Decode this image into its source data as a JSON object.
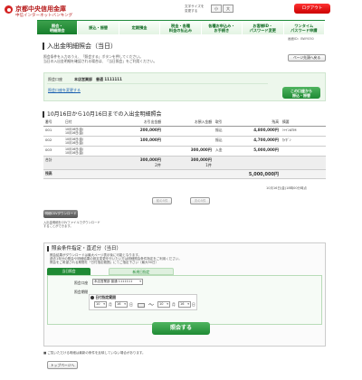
{
  "header": {
    "bank_name": "京都中央信用金庫",
    "service_name": "中信インターネットバンキング",
    "text_size_label": "文字サイズを\n変更する",
    "size_small": "小",
    "size_large": "大",
    "logout_label": "ログアウト"
  },
  "nav": {
    "items": [
      {
        "label": "照会・\n明細照会",
        "active": true
      },
      {
        "label": "振込・振替",
        "active": false
      },
      {
        "label": "定期預金",
        "active": false
      },
      {
        "label": "税金・各種\n料金の払込み",
        "active": false
      },
      {
        "label": "各種お申込み・\nお手続き",
        "active": false
      },
      {
        "label": "お客様ID・\nパスワード変更",
        "active": false
      },
      {
        "label": "ワンタイム\nパスワード申請",
        "active": false
      }
    ]
  },
  "screen_id": "画面ID：BWY050",
  "page": {
    "title": "入出金明細照会（当日）",
    "desc_1": "照会条件を入力のうえ、「照会する」ボタンを押してください。",
    "desc_2": "当日の入出金明細を確認される場合は、「当日照会」をご利用ください。",
    "page_top_button": "ページ先頭へ戻る"
  },
  "account": {
    "label": "照会口座",
    "value": "本店営業部　普通 1111111",
    "change_link": "照会口座を変更する",
    "transfer_button": "この口座から\n振込・振替"
  },
  "statement": {
    "title": "10月16日から10月16日までの入出金明細照会",
    "headers": [
      "番号",
      "日付",
      "お引出金額",
      "お預入金額",
      "取引",
      "残高",
      "摘要"
    ],
    "rows": [
      {
        "no": "001",
        "date": "10月16日(金)\n10月16日(金)",
        "withdraw": "200,000円",
        "deposit": "",
        "type": "振込",
        "balance": "4,800,000円",
        "memo": "ｼｬｲﾝATM"
      },
      {
        "no": "002",
        "date": "10月16日(金)\n10月16日(金)",
        "withdraw": "100,000円",
        "deposit": "",
        "type": "振込",
        "balance": "4,700,000円",
        "memo": "ｶｲﾀﾞﾝ"
      },
      {
        "no": "003",
        "date": "10月16日(金)\n10月16日(金)",
        "withdraw": "",
        "deposit": "300,000円",
        "type": "入金",
        "balance": "5,000,000円",
        "memo": ""
      }
    ],
    "total_label": "合計",
    "total_withdraw": "300,000円",
    "total_withdraw_count": "2件",
    "total_deposit": "300,000円",
    "total_deposit_count": "1件",
    "balance_label": "残高",
    "balance_value": "5,000,000円",
    "as_of": "10月16日(金)18時00分時点"
  },
  "pager": {
    "prev": "前の5件",
    "next": "次の5件"
  },
  "download": {
    "button": "明細CSVダウンロード",
    "note_1": "入出金明細をCSVファイルでダウンロード",
    "note_2": "することができます。"
  },
  "criteria": {
    "title": "照会条件指定・直近分（当日）",
    "desc_1": "照会結果がダウンロードは最大ページ表示後に可能となります。",
    "desc_2": "過去1年分の照会や明細結果の設定変更を行いたい方は明細照会条件指定をご利用ください。",
    "desc_3": "照会をご希望される期間を「日付指定範囲」にてご指定下さい（最大90日）",
    "tab_today": "当日照会",
    "tab_new": "新規日指定",
    "account_label": "照会口座",
    "account_value": "本店営業部 普通 1111111",
    "period_label": "照会期間",
    "date_range_label": "日付指定範囲",
    "from_month": "10",
    "from_day": "16",
    "to_month": "10",
    "to_day": "16",
    "unit_month": "月",
    "unit_day": "日",
    "tilde": "〜",
    "submit": "照会する"
  },
  "footer": {
    "note": "■ ご覧いただける明細は最新の条件を反映していない場合があります。",
    "top_button": "トップページへ"
  },
  "colors": {
    "brand_green": "#1f8a34",
    "brand_red": "#c41a1a",
    "light_green_bg": "#edf7ec"
  }
}
